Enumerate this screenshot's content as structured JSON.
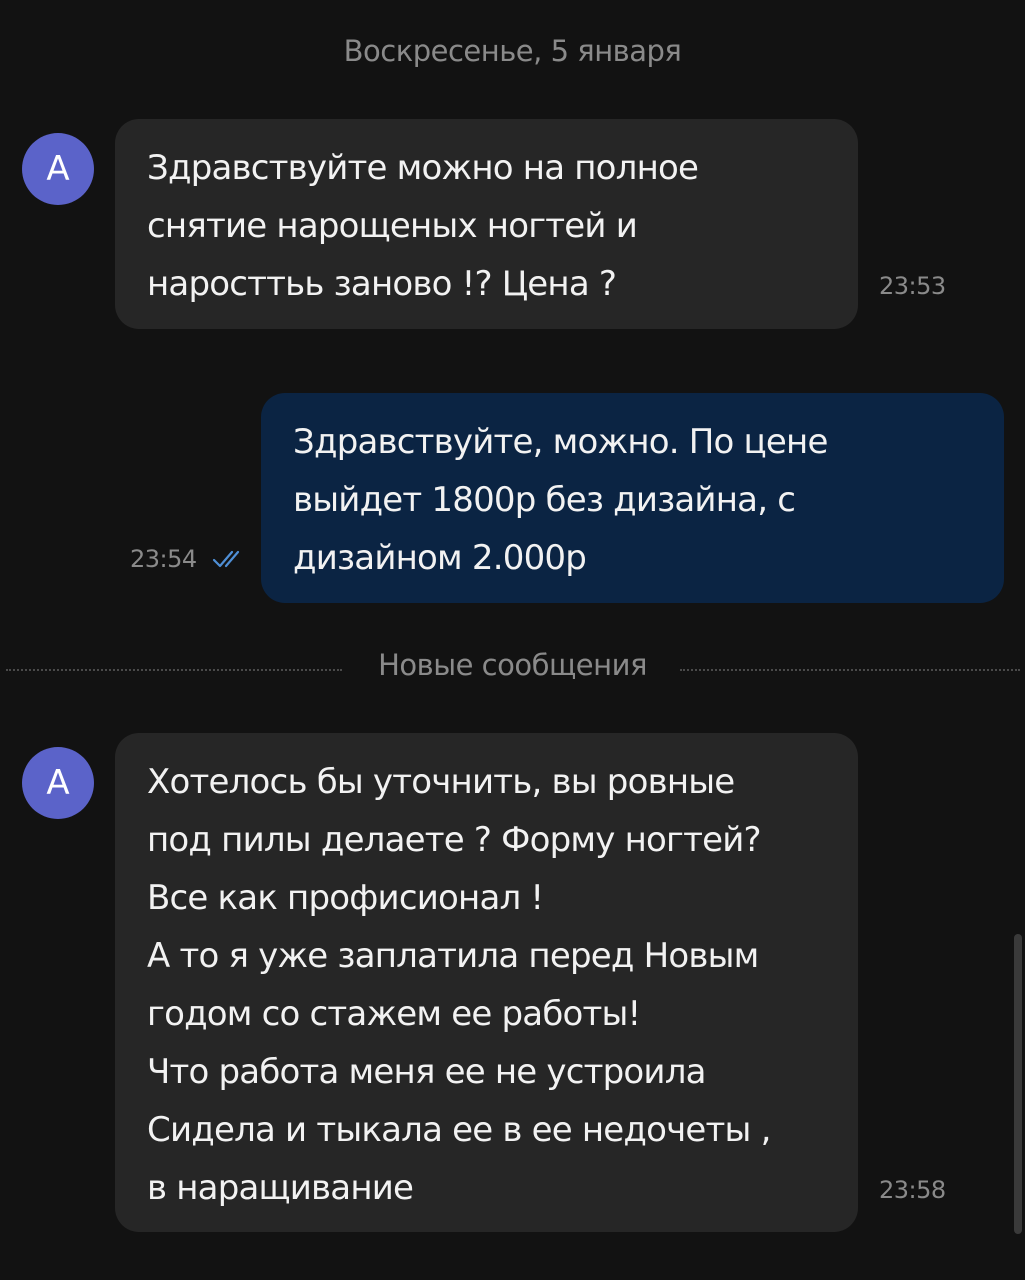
{
  "chat": {
    "date_separator": "Воскресенье, 5 января",
    "new_messages_label": "Новые сообщения",
    "messages": [
      {
        "direction": "incoming",
        "avatar_letter": "А",
        "lines": [
          "Здравствуйте можно на полное",
          "снятие нарощеных ногтей и",
          "нароcттьь заново !? Цена ?"
        ],
        "time": "23:53"
      },
      {
        "direction": "outgoing",
        "lines": [
          "Здравствуйте, можно. По цене",
          "выйдет 1800р без дизайна, с",
          "дизайном 2.000р"
        ],
        "time": "23:54",
        "status_icon": "double-check-icon"
      },
      {
        "direction": "incoming",
        "avatar_letter": "А",
        "lines": [
          "Хотелось бы уточнить, вы ровные",
          "под пилы делаете ? Форму ногтей?",
          "Все как профисионал !",
          "А то я уже заплатила перед Новым",
          "годом со стажем ее работы!",
          "Что работа меня ее не устроила",
          "Сидела и тыкала ее в ее недочеты ,",
          "в наращивание"
        ],
        "time": "23:58"
      }
    ]
  },
  "colors": {
    "background": "#121212",
    "incoming_bubble": "#262626",
    "outgoing_bubble": "#0b2443",
    "avatar": "#5b63c9",
    "read_check": "#4f8fd6"
  }
}
